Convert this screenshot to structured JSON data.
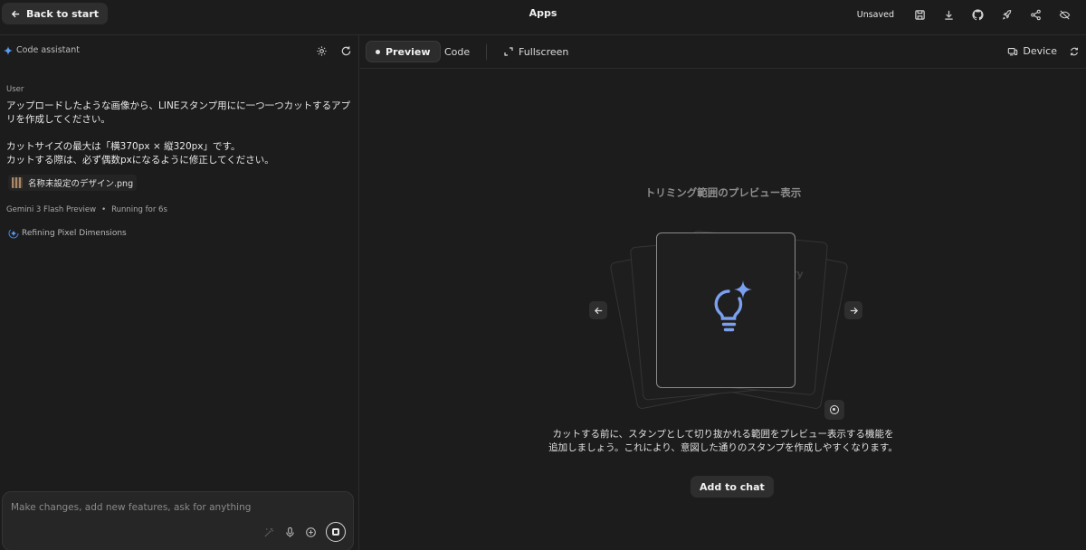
{
  "header": {
    "back_label": "Back to start",
    "title": "Apps",
    "status": "Unsaved",
    "actions": [
      "save-icon",
      "download-icon",
      "github-icon",
      "deploy-rocket-icon",
      "share-icon",
      "hide-eye-icon"
    ]
  },
  "left_panel": {
    "title": "Code assistant",
    "tools": [
      "gear-icon",
      "refresh-icon"
    ],
    "user_label": "User",
    "message_lines": [
      "アップロードしたような画像から、LINEスタンプ用にに一つ一つカットするアプ",
      "リを作成してください。",
      "",
      "カットサイズの最大は「横370px × 縦320px」です。",
      "カットする際は、必ず偶数pxになるように修正してください。"
    ],
    "attachment": "名称未設定のデザイン.png",
    "model": "Gemini 3 Flash Preview",
    "separator": "•",
    "running": "Running for 6s",
    "thinking": "Refining Pixel Dimensions",
    "composer_placeholder": "Make changes, add new features, ask for anything"
  },
  "right_panel": {
    "tabs": {
      "preview": "Preview",
      "code": "Code",
      "fullscreen": "Fullscreen"
    },
    "device_label": "Device",
    "preview_title": "トリミング範囲のプレビュー表示",
    "ghost_text": "ry",
    "description_lines": [
      "カットする前に、スタンプとして切り抜かれる範囲をプレビュー表示する機能を",
      "追加しましょう。これにより、意図した通りのスタンプを作成しやすくなります。"
    ],
    "add_to_chat": "Add to chat",
    "accent_color": "#7ba0f0"
  }
}
